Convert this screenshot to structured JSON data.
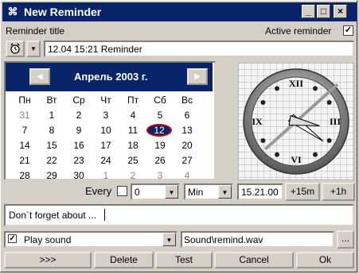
{
  "window": {
    "title": "New Reminder",
    "controls": {
      "minimize": "_",
      "maximize": "□",
      "close": "×"
    }
  },
  "header": {
    "reminder_title_label": "Reminder title",
    "active_label": "Active reminder",
    "active_checked": true
  },
  "title_field": {
    "value": "12.04 15:21 Reminder"
  },
  "calendar": {
    "month_label": "Апрель 2003 г.",
    "weekdays": [
      "Пн",
      "Вт",
      "Ср",
      "Чт",
      "Пт",
      "Сб",
      "Вс"
    ],
    "weeks": [
      [
        "31",
        "1",
        "2",
        "3",
        "4",
        "5",
        "6"
      ],
      [
        "7",
        "8",
        "9",
        "10",
        "11",
        "12",
        "13"
      ],
      [
        "14",
        "15",
        "16",
        "17",
        "18",
        "19",
        "20"
      ],
      [
        "21",
        "22",
        "23",
        "24",
        "25",
        "26",
        "27"
      ],
      [
        "28",
        "29",
        "30",
        "1",
        "2",
        "3",
        "4"
      ]
    ],
    "selected_day": "12"
  },
  "clock": {
    "numerals": {
      "top": "XII",
      "right": "III",
      "bottom": "VI",
      "left": "IX"
    },
    "hour": 15,
    "minute": 21,
    "second": 38
  },
  "repeat": {
    "every_label": "Every",
    "every_checked": false,
    "count_value": "0",
    "unit_value": "Min"
  },
  "time": {
    "value": "15.21.00",
    "plus15_label": "+15m",
    "plus1h_label": "+1h"
  },
  "message": {
    "value": "Don`t forget about ..."
  },
  "sound": {
    "play_label": "Play sound",
    "play_checked": true,
    "file_value": "Sound\\remind.wav",
    "browse_label": "..."
  },
  "buttons": {
    "more": ">>>",
    "delete": "Delete",
    "test": "Test",
    "cancel": "Cancel",
    "ok": "Ok"
  }
}
